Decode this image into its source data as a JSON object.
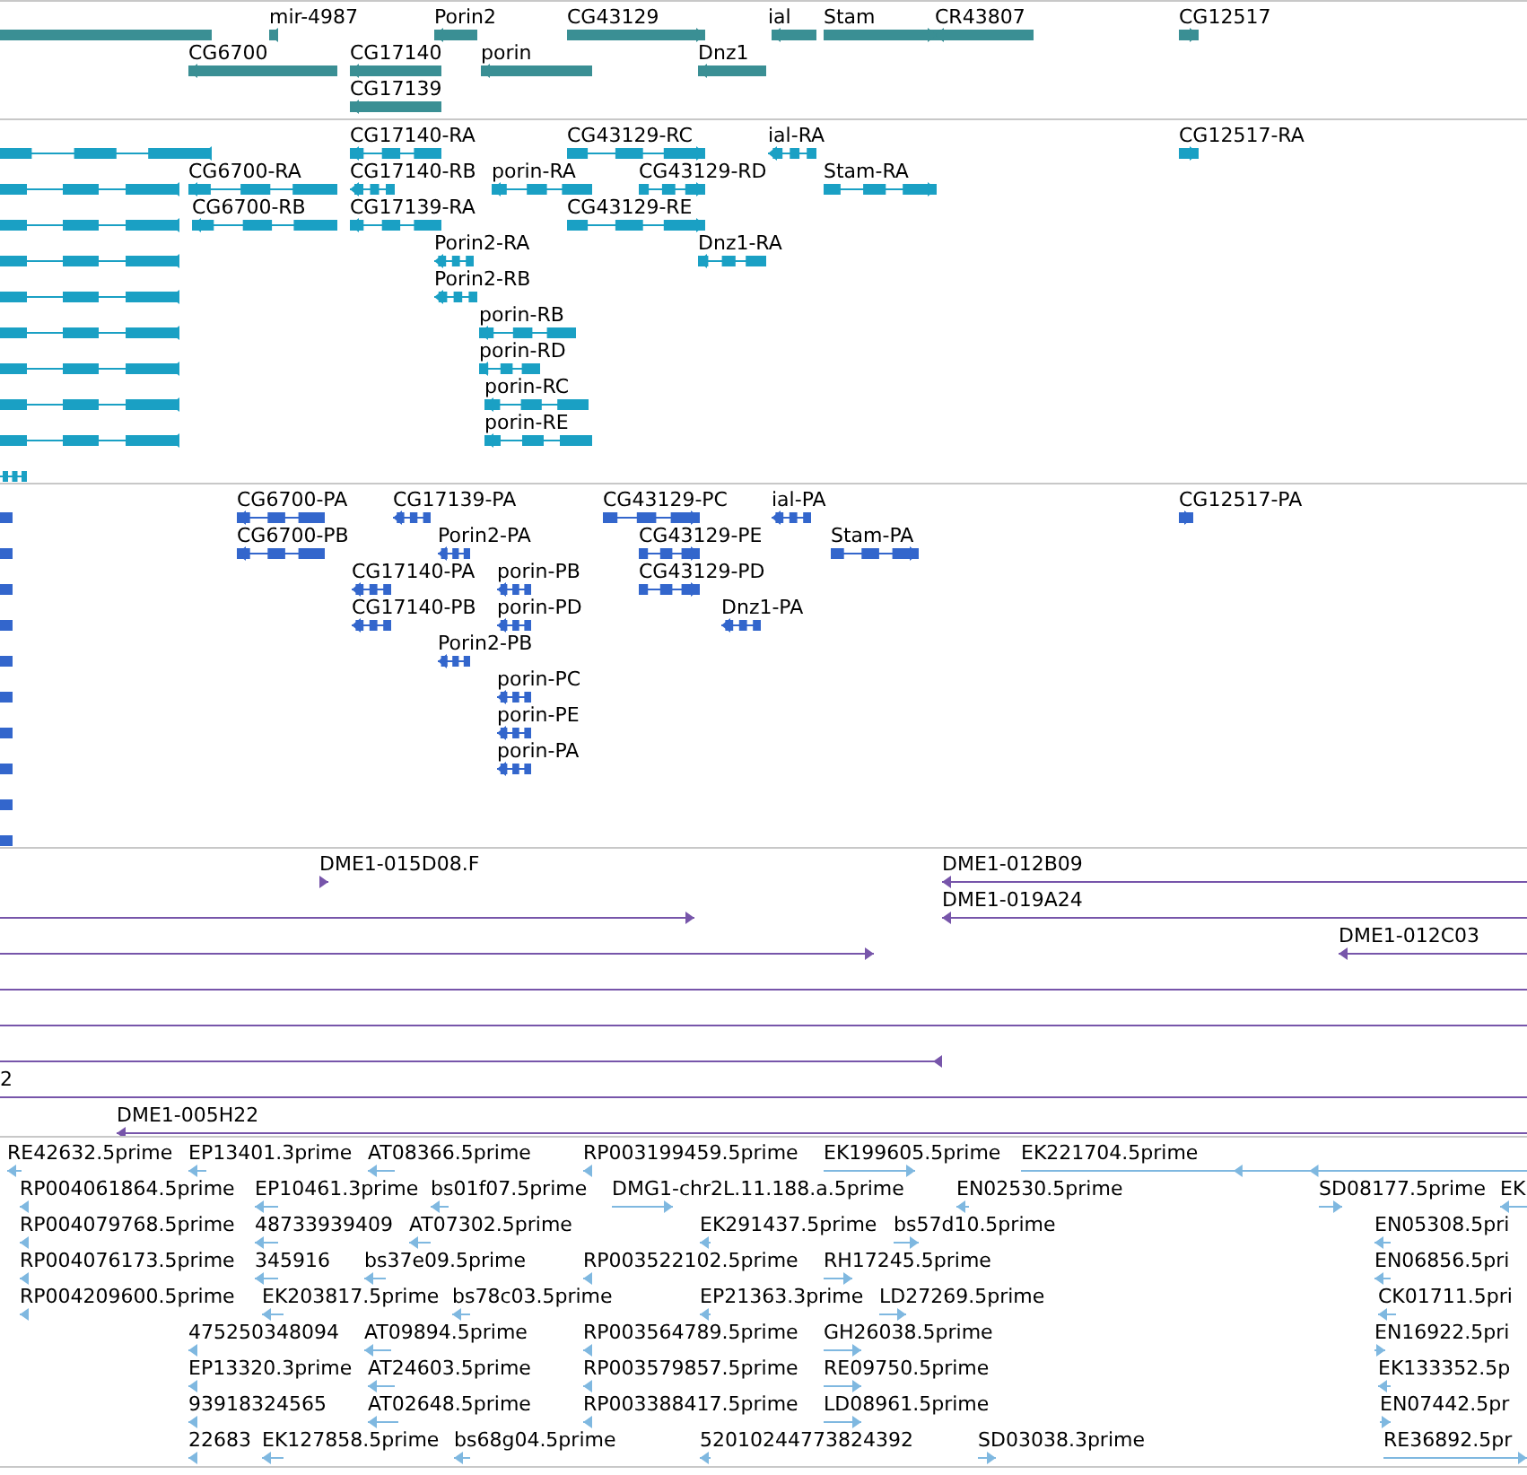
{
  "tracks": [
    {
      "kind": "gene",
      "color": "#3a8f94",
      "rows": [
        {
          "features": [
            {
              "kind": "plain"
            },
            {
              "label": "mir-4987",
              "kind": "reverse"
            },
            {
              "label": "Porin2",
              "kind": "reverse"
            },
            {
              "label": "CG43129",
              "kind": "forward"
            },
            {
              "label": "ial",
              "kind": "reverse"
            },
            {
              "label": "Stam",
              "kind": "forward"
            },
            {
              "label": "CR43807",
              "kind": "reverse"
            },
            {
              "label": "CG12517",
              "kind": "forward"
            }
          ]
        },
        {
          "features": [
            {
              "label": "CG6700",
              "kind": "reverse"
            },
            {
              "label": "CG17140",
              "kind": "reverse"
            },
            {
              "label": "porin",
              "kind": "reverse"
            },
            {
              "label": "Dnz1",
              "kind": "reverse"
            }
          ]
        },
        {
          "features": [
            {
              "label": "CG17139",
              "kind": "reverse"
            }
          ]
        }
      ]
    },
    {
      "kind": "transcript",
      "color": "#1aa0c4",
      "rows": [
        {
          "features": [
            {
              "kind": "reverse"
            },
            {
              "label": "CG17140-RA",
              "kind": "reverse"
            },
            {
              "label": "CG43129-RC",
              "kind": "forward"
            },
            {
              "label": "ial-RA",
              "kind": "reverse"
            },
            {
              "label": "CG12517-RA",
              "kind": "forward"
            }
          ]
        },
        {
          "features": [
            {
              "kind": "reverse"
            },
            {
              "label": "CG6700-RA",
              "kind": "reverse"
            },
            {
              "label": "CG17140-RB",
              "kind": "reverse"
            },
            {
              "label": "porin-RA",
              "kind": "reverse"
            },
            {
              "label": "CG43129-RD",
              "kind": "forward"
            },
            {
              "label": "Stam-RA",
              "kind": "forward"
            }
          ]
        },
        {
          "features": [
            {
              "kind": "reverse"
            },
            {
              "label": "CG6700-RB",
              "kind": "reverse"
            },
            {
              "label": "CG17139-RA",
              "kind": "reverse"
            },
            {
              "label": "CG43129-RE",
              "kind": "forward"
            }
          ]
        },
        {
          "features": [
            {
              "kind": "reverse"
            },
            {
              "label": "Porin2-RA",
              "kind": "reverse"
            },
            {
              "label": "Dnz1-RA",
              "kind": "reverse"
            }
          ]
        },
        {
          "features": [
            {
              "kind": "reverse"
            },
            {
              "label": "Porin2-RB",
              "kind": "reverse"
            }
          ]
        },
        {
          "features": [
            {
              "kind": "reverse"
            },
            {
              "label": "porin-RB",
              "kind": "reverse"
            }
          ]
        },
        {
          "features": [
            {
              "kind": "reverse"
            },
            {
              "label": "porin-RD",
              "kind": "reverse"
            }
          ]
        },
        {
          "features": [
            {
              "kind": "reverse"
            },
            {
              "label": "porin-RC",
              "kind": "reverse"
            }
          ]
        },
        {
          "features": [
            {
              "kind": "reverse"
            },
            {
              "label": "porin-RE",
              "kind": "reverse"
            }
          ]
        },
        {
          "features": [
            {
              "kind": "plain"
            }
          ]
        }
      ]
    },
    {
      "kind": "protein",
      "color": "#3366cc",
      "rows": [
        {
          "features": [
            {
              "kind": "plain"
            },
            {
              "label": "CG6700-PA",
              "kind": "reverse"
            },
            {
              "label": "CG17139-PA",
              "kind": "reverse"
            },
            {
              "label": "CG43129-PC",
              "kind": "forward"
            },
            {
              "label": "ial-PA",
              "kind": "reverse"
            },
            {
              "label": "CG12517-PA",
              "kind": "forward"
            }
          ]
        },
        {
          "features": [
            {
              "kind": "plain"
            },
            {
              "label": "CG6700-PB",
              "kind": "reverse"
            },
            {
              "label": "Porin2-PA",
              "kind": "reverse"
            },
            {
              "label": "CG43129-PE",
              "kind": "forward"
            },
            {
              "label": "Stam-PA",
              "kind": "forward"
            }
          ]
        },
        {
          "features": [
            {
              "kind": "plain"
            },
            {
              "label": "CG17140-PA",
              "kind": "reverse"
            },
            {
              "label": "porin-PB",
              "kind": "reverse"
            },
            {
              "label": "CG43129-PD",
              "kind": "forward"
            }
          ]
        },
        {
          "features": [
            {
              "kind": "plain"
            },
            {
              "label": "CG17140-PB",
              "kind": "reverse"
            },
            {
              "label": "porin-PD",
              "kind": "reverse"
            },
            {
              "label": "Dnz1-PA",
              "kind": "reverse"
            }
          ]
        },
        {
          "features": [
            {
              "kind": "plain"
            },
            {
              "label": "Porin2-PB",
              "kind": "reverse"
            }
          ]
        },
        {
          "features": [
            {
              "kind": "plain"
            },
            {
              "label": "porin-PC",
              "kind": "reverse"
            }
          ]
        },
        {
          "features": [
            {
              "kind": "plain"
            },
            {
              "label": "porin-PE",
              "kind": "reverse"
            }
          ]
        },
        {
          "features": [
            {
              "kind": "plain"
            },
            {
              "label": "porin-PA",
              "kind": "reverse"
            }
          ]
        },
        {
          "features": [
            {
              "kind": "plain"
            }
          ]
        },
        {
          "features": [
            {
              "kind": "plain"
            }
          ]
        }
      ]
    },
    {
      "kind": "clone",
      "color": "#7755aa",
      "rows": [
        {
          "features": [
            {
              "label": "DME1-015D08.F",
              "kind": "forward"
            },
            {
              "label": "DME1-012B09",
              "kind": "reverse"
            }
          ]
        },
        {
          "features": [
            {
              "kind": "forward"
            },
            {
              "label": "DME1-019A24",
              "kind": "reverse"
            }
          ]
        },
        {
          "features": [
            {
              "kind": "forward"
            },
            {
              "label": "DME1-012C03",
              "kind": "reverse"
            }
          ]
        },
        {
          "features": [
            {
              "kind": "plain"
            }
          ]
        },
        {
          "features": [
            {
              "kind": "plain"
            }
          ]
        },
        {
          "features": [
            {
              "kind": "reverse"
            }
          ]
        },
        {
          "features": [
            {
              "label": "2",
              "kind": "plain"
            }
          ]
        },
        {
          "features": [
            {
              "label": "DME1-005H22",
              "kind": "reverse"
            }
          ]
        }
      ]
    },
    {
      "kind": "est",
      "color": "#7fb8e0",
      "rows": [
        {
          "features": [
            {
              "label": "RE42632.5prime",
              "kind": "reverse"
            },
            {
              "label": "EP13401.3prime",
              "kind": "reverse"
            },
            {
              "label": "AT08366.5prime",
              "kind": "reverse"
            },
            {
              "label": "RP003199459.5prime",
              "kind": "reverse"
            },
            {
              "label": "EK199605.5prime",
              "kind": "forward"
            },
            {
              "label": "EK221704.5prime",
              "kind": "reverse"
            }
          ]
        },
        {
          "features": [
            {
              "label": "RP004061864.5prime",
              "kind": "reverse"
            },
            {
              "label": "EP10461.3prime",
              "kind": "reverse"
            },
            {
              "label": "bs01f07.5prime",
              "kind": "reverse"
            },
            {
              "label": "DMG1-chr2L.11.188.a.5prime",
              "kind": "forward"
            },
            {
              "label": "EN02530.5prime",
              "kind": "reverse"
            },
            {
              "label": "SD08177.5prime",
              "kind": "forward"
            },
            {
              "label": "EK",
              "kind": "reverse"
            }
          ]
        },
        {
          "features": [
            {
              "label": "RP004079768.5prime",
              "kind": "reverse"
            },
            {
              "label": "48733939409",
              "kind": "reverse"
            },
            {
              "label": "AT07302.5prime",
              "kind": "reverse"
            },
            {
              "label": "EK291437.5prime",
              "kind": "reverse"
            },
            {
              "label": "bs57d10.5prime",
              "kind": "forward"
            },
            {
              "label": "EN05308.5pri",
              "kind": "reverse"
            }
          ]
        },
        {
          "features": [
            {
              "label": "RP004076173.5prime",
              "kind": "reverse"
            },
            {
              "label": "345916",
              "kind": "reverse"
            },
            {
              "label": "bs37e09.5prime",
              "kind": "reverse"
            },
            {
              "label": "RP003522102.5prime",
              "kind": "reverse"
            },
            {
              "label": "RH17245.5prime",
              "kind": "forward"
            },
            {
              "label": "EN06856.5pri",
              "kind": "reverse"
            }
          ]
        },
        {
          "features": [
            {
              "label": "RP004209600.5prime",
              "kind": "reverse"
            },
            {
              "label": "EK203817.5prime",
              "kind": "reverse"
            },
            {
              "label": "bs78c03.5prime",
              "kind": "reverse"
            },
            {
              "label": "EP21363.3prime",
              "kind": "reverse"
            },
            {
              "label": "LD27269.5prime",
              "kind": "forward"
            },
            {
              "label": "CK01711.5pri",
              "kind": "reverse"
            }
          ]
        },
        {
          "features": [
            {
              "label": "475250348094",
              "kind": "reverse"
            },
            {
              "label": "AT09894.5prime",
              "kind": "reverse"
            },
            {
              "label": "RP003564789.5prime",
              "kind": "reverse"
            },
            {
              "label": "GH26038.5prime",
              "kind": "forward"
            },
            {
              "label": "EN16922.5pri",
              "kind": "forward"
            }
          ]
        },
        {
          "features": [
            {
              "label": "EP13320.3prime",
              "kind": "reverse"
            },
            {
              "label": "AT24603.5prime",
              "kind": "reverse"
            },
            {
              "label": "RP003579857.5prime",
              "kind": "reverse"
            },
            {
              "label": "RE09750.5prime",
              "kind": "forward"
            },
            {
              "label": "EK133352.5p",
              "kind": "reverse"
            }
          ]
        },
        {
          "features": [
            {
              "label": "93918324565",
              "kind": "reverse"
            },
            {
              "label": "AT02648.5prime",
              "kind": "reverse"
            },
            {
              "label": "RP003388417.5prime",
              "kind": "reverse"
            },
            {
              "label": "LD08961.5prime",
              "kind": "forward"
            },
            {
              "label": "EN07442.5pr",
              "kind": "forward"
            }
          ]
        },
        {
          "features": [
            {
              "label": "22683",
              "kind": "reverse"
            },
            {
              "label": "EK127858.5prime",
              "kind": "reverse"
            },
            {
              "label": "bs68g04.5prime",
              "kind": "reverse"
            },
            {
              "label": "52010244773824392",
              "kind": "reverse"
            },
            {
              "label": "SD03038.3prime",
              "kind": "forward"
            },
            {
              "label": "RE36892.5pr",
              "kind": "forward"
            }
          ]
        }
      ]
    }
  ]
}
